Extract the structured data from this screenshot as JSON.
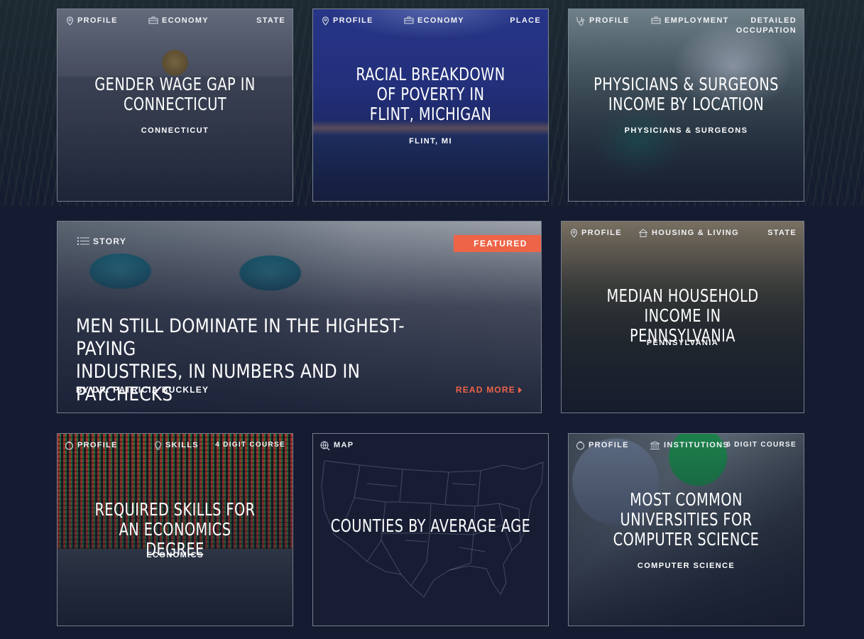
{
  "cards": [
    {
      "meta": {
        "left": "Profile",
        "middle": "Economy",
        "right": "State"
      },
      "title": "Gender Wage Gap in Connecticut",
      "subtitle": "Connecticut"
    },
    {
      "meta": {
        "left": "Profile",
        "middle": "Economy",
        "right": "Place"
      },
      "title": "Racial Breakdown of Poverty in Flint, Michigan",
      "subtitle": "Flint, MI"
    },
    {
      "meta": {
        "left": "Profile",
        "middle": "Employment",
        "right_line1": "Detailed",
        "right_line2": "Occupation"
      },
      "title": "Physicians & Surgeons Income by Location",
      "subtitle": "Physicians & Surgeons"
    },
    {
      "meta": {
        "right": "State",
        "left": "Profile",
        "middle": "Housing & Living"
      },
      "title": "Median Household Income in Pennsylvania",
      "subtitle": "Pennsylvania"
    },
    {
      "meta": {
        "left": "Profile",
        "middle": "Skills",
        "right": "4 Digit Course"
      },
      "title": "Required Skills for an Economics Degree",
      "subtitle": "Economics"
    },
    {
      "meta": {
        "left": "Map"
      },
      "title": "Counties by Average Age"
    },
    {
      "meta": {
        "left": "Profile",
        "middle": "Institutions",
        "right": "6 Digit Course"
      },
      "title": "Most Common Universities for Computer Science",
      "subtitle": "Computer Science"
    }
  ],
  "featured_story": {
    "type_label": "Story",
    "badge": "Featured",
    "title_line1": "Men Still Dominate in the Highest-Paying",
    "title_line2": "Industries, in Numbers and in Paychecks",
    "byline": "BY DR. PATRICIA BUCKLEY",
    "read_more": "Read More"
  },
  "colors": {
    "background": "#151b30",
    "accent": "#ee6447",
    "card_border": "#c8cddc"
  }
}
